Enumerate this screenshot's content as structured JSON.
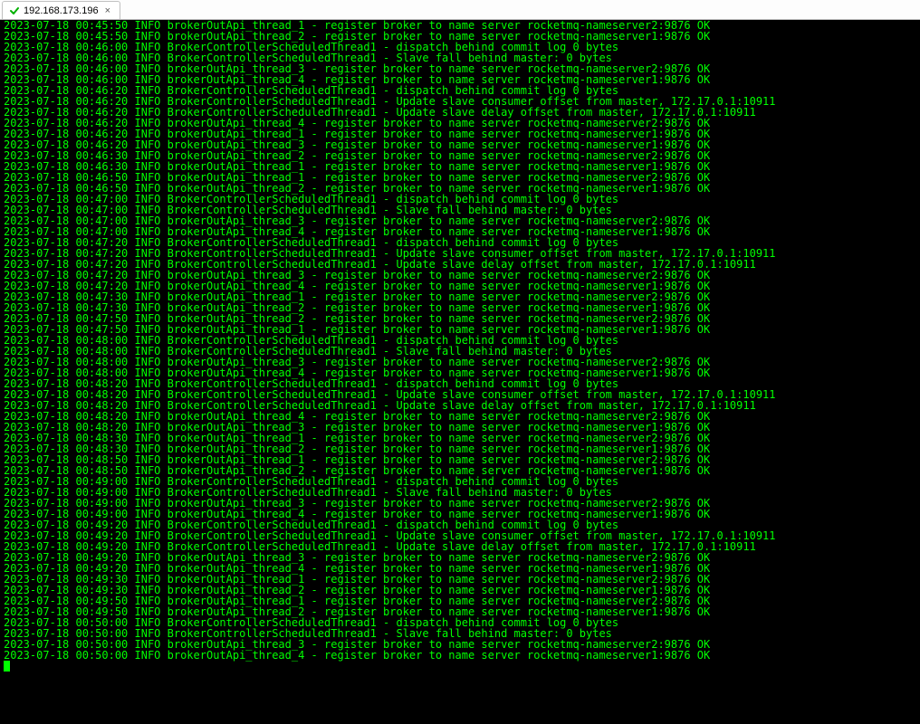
{
  "tab": {
    "title": "192.168.173.196",
    "status": "connected",
    "close_glyph": "×"
  },
  "terminal": {
    "prefix_date": "2023-07-18",
    "level": "INFO",
    "ns1": "rocketmq-nameserver1:9876",
    "ns2": "rocketmq-nameserver2:9876",
    "master_ip": "172.17.0.1:10911",
    "reg_msg_t1": "brokerOutApi_thread_1 - register broker to name server",
    "reg_msg_t2": "brokerOutApi_thread_2 - register broker to name server",
    "reg_msg_t3": "brokerOutApi_thread_3 - register broker to name server",
    "reg_msg_t4": "brokerOutApi_thread_4 - register broker to name server",
    "sched_thread": "BrokerControllerScheduledThread1",
    "dispatch_msg": "dispatch behind commit log 0 bytes",
    "slave_fall_msg": "Slave fall behind master: 0 bytes",
    "upd_consumer_msg": "Update slave consumer offset from master,",
    "upd_delay_msg": "Update slave delay offset from master,",
    "ok": "OK",
    "lines": [
      {
        "time": "00:45:50",
        "msg": "brokerOutApi_thread_1 - register broker to name server rocketmq-nameserver2:9876 OK"
      },
      {
        "time": "00:45:50",
        "msg": "brokerOutApi_thread_2 - register broker to name server rocketmq-nameserver1:9876 OK"
      },
      {
        "time": "00:46:00",
        "msg": "BrokerControllerScheduledThread1 - dispatch behind commit log 0 bytes"
      },
      {
        "time": "00:46:00",
        "msg": "BrokerControllerScheduledThread1 - Slave fall behind master: 0 bytes"
      },
      {
        "time": "00:46:00",
        "msg": "brokerOutApi_thread_3 - register broker to name server rocketmq-nameserver2:9876 OK"
      },
      {
        "time": "00:46:00",
        "msg": "brokerOutApi_thread_4 - register broker to name server rocketmq-nameserver1:9876 OK"
      },
      {
        "time": "00:46:20",
        "msg": "BrokerControllerScheduledThread1 - dispatch behind commit log 0 bytes"
      },
      {
        "time": "00:46:20",
        "msg": "BrokerControllerScheduledThread1 - Update slave consumer offset from master, 172.17.0.1:10911"
      },
      {
        "time": "00:46:20",
        "msg": "BrokerControllerScheduledThread1 - Update slave delay offset from master, 172.17.0.1:10911"
      },
      {
        "time": "00:46:20",
        "msg": "brokerOutApi_thread_4 - register broker to name server rocketmq-nameserver2:9876 OK"
      },
      {
        "time": "00:46:20",
        "msg": "brokerOutApi_thread_1 - register broker to name server rocketmq-nameserver1:9876 OK"
      },
      {
        "time": "00:46:20",
        "msg": "brokerOutApi_thread_3 - register broker to name server rocketmq-nameserver1:9876 OK"
      },
      {
        "time": "00:46:30",
        "msg": "brokerOutApi_thread_2 - register broker to name server rocketmq-nameserver2:9876 OK"
      },
      {
        "time": "00:46:30",
        "msg": "brokerOutApi_thread_1 - register broker to name server rocketmq-nameserver1:9876 OK"
      },
      {
        "time": "00:46:50",
        "msg": "brokerOutApi_thread_1 - register broker to name server rocketmq-nameserver2:9876 OK"
      },
      {
        "time": "00:46:50",
        "msg": "brokerOutApi_thread_2 - register broker to name server rocketmq-nameserver1:9876 OK"
      },
      {
        "time": "00:47:00",
        "msg": "BrokerControllerScheduledThread1 - dispatch behind commit log 0 bytes"
      },
      {
        "time": "00:47:00",
        "msg": "BrokerControllerScheduledThread1 - Slave fall behind master: 0 bytes"
      },
      {
        "time": "00:47:00",
        "msg": "brokerOutApi_thread_3 - register broker to name server rocketmq-nameserver2:9876 OK"
      },
      {
        "time": "00:47:00",
        "msg": "brokerOutApi_thread_4 - register broker to name server rocketmq-nameserver1:9876 OK"
      },
      {
        "time": "00:47:20",
        "msg": "BrokerControllerScheduledThread1 - dispatch behind commit log 0 bytes"
      },
      {
        "time": "00:47:20",
        "msg": "BrokerControllerScheduledThread1 - Update slave consumer offset from master, 172.17.0.1:10911"
      },
      {
        "time": "00:47:20",
        "msg": "BrokerControllerScheduledThread1 - Update slave delay offset from master, 172.17.0.1:10911"
      },
      {
        "time": "00:47:20",
        "msg": "brokerOutApi_thread_3 - register broker to name server rocketmq-nameserver2:9876 OK"
      },
      {
        "time": "00:47:20",
        "msg": "brokerOutApi_thread_4 - register broker to name server rocketmq-nameserver1:9876 OK"
      },
      {
        "time": "00:47:30",
        "msg": "brokerOutApi_thread_1 - register broker to name server rocketmq-nameserver2:9876 OK"
      },
      {
        "time": "00:47:30",
        "msg": "brokerOutApi_thread_2 - register broker to name server rocketmq-nameserver1:9876 OK"
      },
      {
        "time": "00:47:50",
        "msg": "brokerOutApi_thread_2 - register broker to name server rocketmq-nameserver2:9876 OK"
      },
      {
        "time": "00:47:50",
        "msg": "brokerOutApi_thread_1 - register broker to name server rocketmq-nameserver1:9876 OK"
      },
      {
        "time": "00:48:00",
        "msg": "BrokerControllerScheduledThread1 - dispatch behind commit log 0 bytes"
      },
      {
        "time": "00:48:00",
        "msg": "BrokerControllerScheduledThread1 - Slave fall behind master: 0 bytes"
      },
      {
        "time": "00:48:00",
        "msg": "brokerOutApi_thread_3 - register broker to name server rocketmq-nameserver2:9876 OK"
      },
      {
        "time": "00:48:00",
        "msg": "brokerOutApi_thread_4 - register broker to name server rocketmq-nameserver1:9876 OK"
      },
      {
        "time": "00:48:20",
        "msg": "BrokerControllerScheduledThread1 - dispatch behind commit log 0 bytes"
      },
      {
        "time": "00:48:20",
        "msg": "BrokerControllerScheduledThread1 - Update slave consumer offset from master, 172.17.0.1:10911"
      },
      {
        "time": "00:48:20",
        "msg": "BrokerControllerScheduledThread1 - Update slave delay offset from master, 172.17.0.1:10911"
      },
      {
        "time": "00:48:20",
        "msg": "brokerOutApi_thread_4 - register broker to name server rocketmq-nameserver2:9876 OK"
      },
      {
        "time": "00:48:20",
        "msg": "brokerOutApi_thread_3 - register broker to name server rocketmq-nameserver1:9876 OK"
      },
      {
        "time": "00:48:30",
        "msg": "brokerOutApi_thread_1 - register broker to name server rocketmq-nameserver2:9876 OK"
      },
      {
        "time": "00:48:30",
        "msg": "brokerOutApi_thread_2 - register broker to name server rocketmq-nameserver1:9876 OK"
      },
      {
        "time": "00:48:50",
        "msg": "brokerOutApi_thread_1 - register broker to name server rocketmq-nameserver2:9876 OK"
      },
      {
        "time": "00:48:50",
        "msg": "brokerOutApi_thread_2 - register broker to name server rocketmq-nameserver1:9876 OK"
      },
      {
        "time": "00:49:00",
        "msg": "BrokerControllerScheduledThread1 - dispatch behind commit log 0 bytes"
      },
      {
        "time": "00:49:00",
        "msg": "BrokerControllerScheduledThread1 - Slave fall behind master: 0 bytes"
      },
      {
        "time": "00:49:00",
        "msg": "brokerOutApi_thread_3 - register broker to name server rocketmq-nameserver2:9876 OK"
      },
      {
        "time": "00:49:00",
        "msg": "brokerOutApi_thread_4 - register broker to name server rocketmq-nameserver1:9876 OK"
      },
      {
        "time": "00:49:20",
        "msg": "BrokerControllerScheduledThread1 - dispatch behind commit log 0 bytes"
      },
      {
        "time": "00:49:20",
        "msg": "BrokerControllerScheduledThread1 - Update slave consumer offset from master, 172.17.0.1:10911"
      },
      {
        "time": "00:49:20",
        "msg": "BrokerControllerScheduledThread1 - Update slave delay offset from master, 172.17.0.1:10911"
      },
      {
        "time": "00:49:20",
        "msg": "brokerOutApi_thread_3 - register broker to name server rocketmq-nameserver2:9876 OK"
      },
      {
        "time": "00:49:20",
        "msg": "brokerOutApi_thread_4 - register broker to name server rocketmq-nameserver1:9876 OK"
      },
      {
        "time": "00:49:30",
        "msg": "brokerOutApi_thread_1 - register broker to name server rocketmq-nameserver2:9876 OK"
      },
      {
        "time": "00:49:30",
        "msg": "brokerOutApi_thread_2 - register broker to name server rocketmq-nameserver1:9876 OK"
      },
      {
        "time": "00:49:50",
        "msg": "brokerOutApi_thread_1 - register broker to name server rocketmq-nameserver2:9876 OK"
      },
      {
        "time": "00:49:50",
        "msg": "brokerOutApi_thread_2 - register broker to name server rocketmq-nameserver1:9876 OK"
      },
      {
        "time": "00:50:00",
        "msg": "BrokerControllerScheduledThread1 - dispatch behind commit log 0 bytes"
      },
      {
        "time": "00:50:00",
        "msg": "BrokerControllerScheduledThread1 - Slave fall behind master: 0 bytes"
      },
      {
        "time": "00:50:00",
        "msg": "brokerOutApi_thread_3 - register broker to name server rocketmq-nameserver2:9876 OK"
      },
      {
        "time": "00:50:00",
        "msg": "brokerOutApi_thread_4 - register broker to name server rocketmq-nameserver1:9876 OK"
      }
    ]
  }
}
